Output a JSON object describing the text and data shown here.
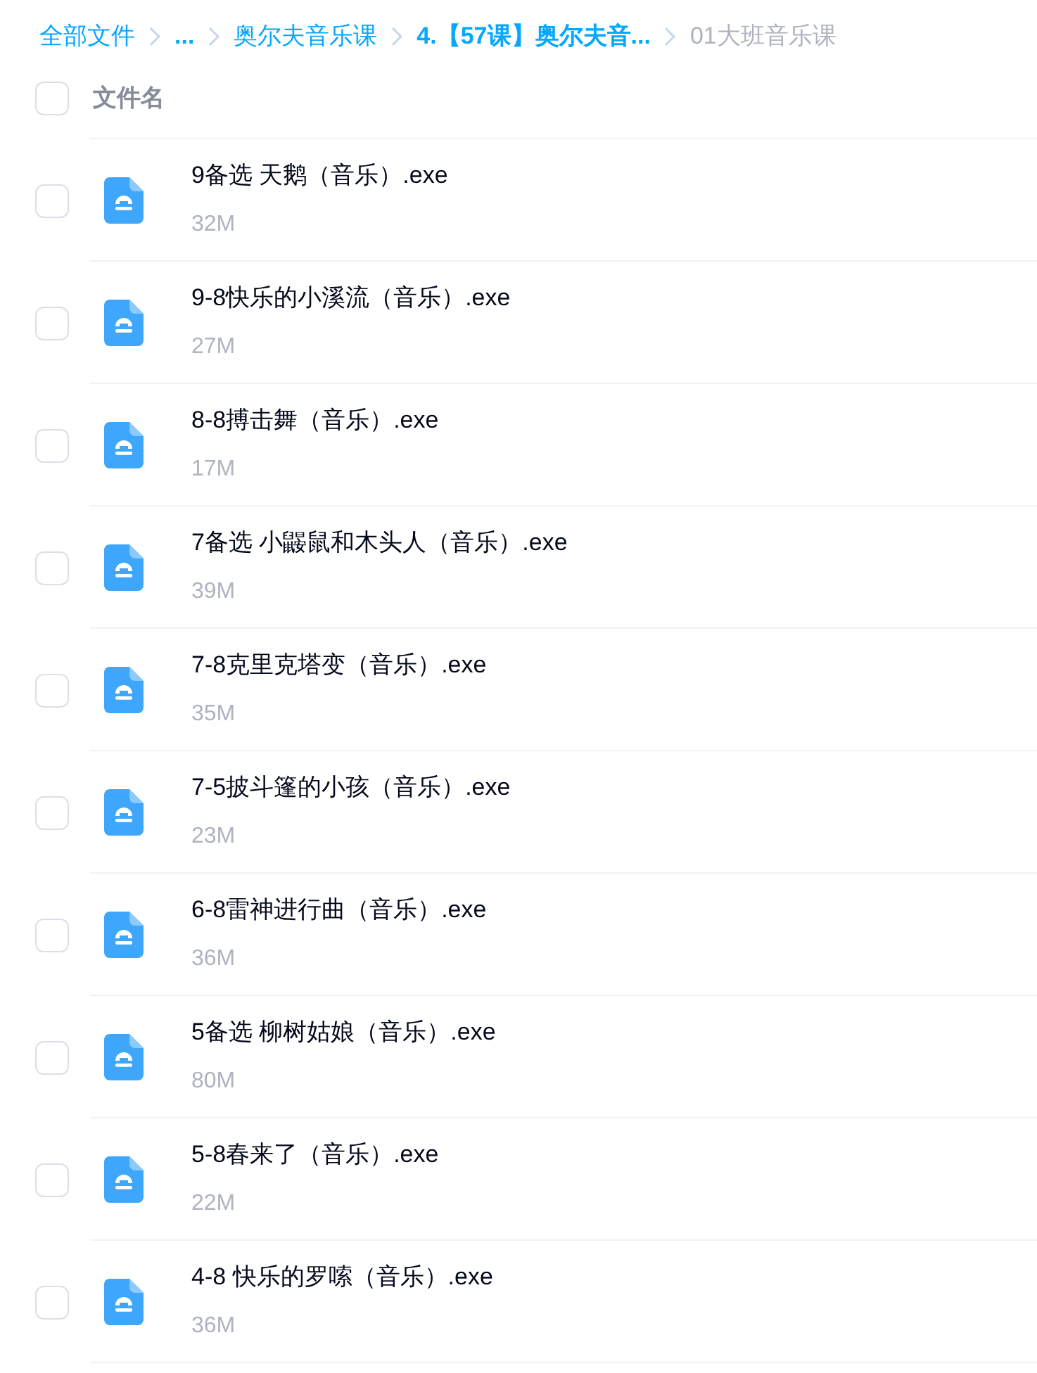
{
  "breadcrumb": [
    {
      "label": "全部文件",
      "kind": "link"
    },
    {
      "label": "...",
      "kind": "strong_link"
    },
    {
      "label": "奥尔夫音乐课",
      "kind": "link"
    },
    {
      "label": "4.【57课】奥尔夫音...",
      "kind": "strong_link"
    },
    {
      "label": "01大班音乐课",
      "kind": "current"
    }
  ],
  "header": {
    "label": "文件名",
    "checked": false
  },
  "files": [
    {
      "name": "9备选 天鹅（音乐）.exe",
      "size": "32M",
      "checked": false
    },
    {
      "name": "9-8快乐的小溪流（音乐）.exe",
      "size": "27M",
      "checked": false
    },
    {
      "name": "8-8搏击舞（音乐）.exe",
      "size": "17M",
      "checked": false
    },
    {
      "name": "7备选 小鼹鼠和木头人（音乐）.exe",
      "size": "39M",
      "checked": false
    },
    {
      "name": "7-8克里克塔变（音乐）.exe",
      "size": "35M",
      "checked": false
    },
    {
      "name": "7-5披斗篷的小孩（音乐）.exe",
      "size": "23M",
      "checked": false
    },
    {
      "name": "6-8雷神进行曲（音乐）.exe",
      "size": "36M",
      "checked": false
    },
    {
      "name": "5备选 柳树姑娘（音乐）.exe",
      "size": "80M",
      "checked": false
    },
    {
      "name": "5-8春来了（音乐）.exe",
      "size": "22M",
      "checked": false
    },
    {
      "name": "4-8 快乐的罗嗦（音乐）.exe",
      "size": "36M",
      "checked": false
    }
  ]
}
